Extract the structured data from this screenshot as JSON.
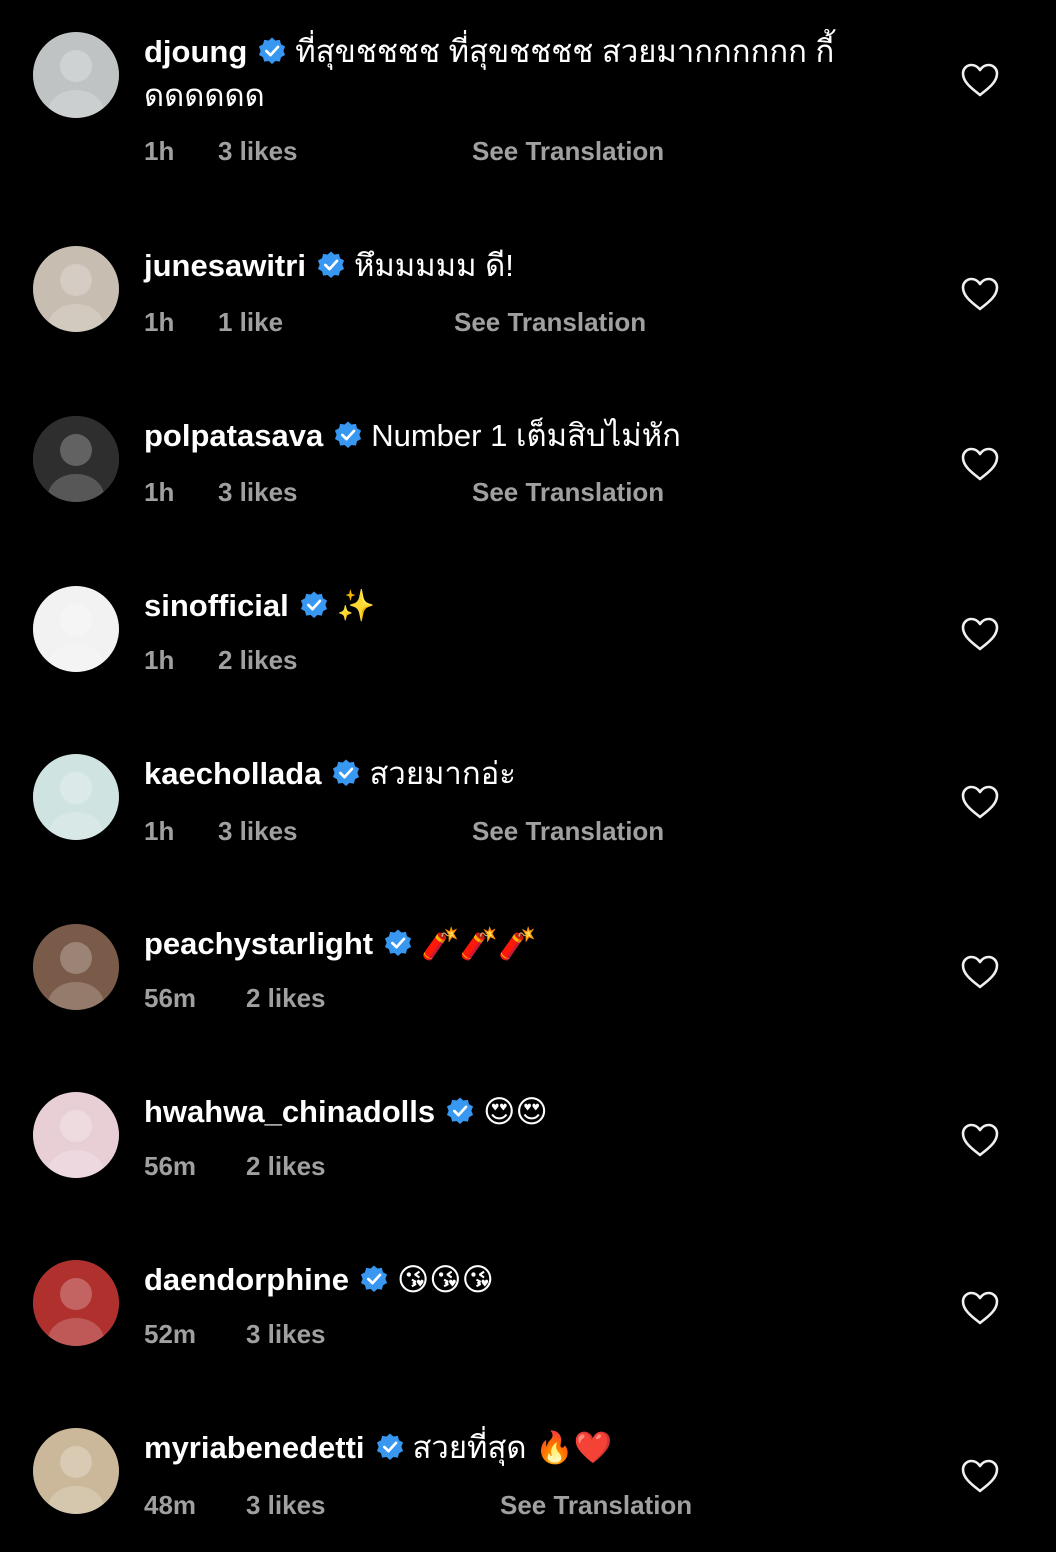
{
  "comments": [
    {
      "username": "djoung",
      "text": "ที่สุขชชชช ที่สุขชชชช สวยมากกกกกก กี้",
      "text2": "ดดดดดด",
      "time": "1h",
      "likes": "3 likes",
      "translate": "See Translation",
      "avatar_color": "#bfc3c4"
    },
    {
      "username": "junesawitri",
      "text": "หึมมมมม ดี!",
      "time": "1h",
      "likes": "1 like",
      "translate": "See Translation",
      "avatar_color": "#c7bdb0"
    },
    {
      "username": "polpatasava",
      "text": "Number 1 เต็มสิบไม่หัก",
      "time": "1h",
      "likes": "3 likes",
      "translate": "See Translation",
      "avatar_color": "#2e2e2e"
    },
    {
      "username": "sinofficial",
      "text": "✨",
      "time": "1h",
      "likes": "2 likes",
      "translate": "",
      "avatar_color": "#f2f2f2"
    },
    {
      "username": "kaechollada",
      "text": "สวยมากอ่ะ",
      "time": "1h",
      "likes": "3 likes",
      "translate": "See Translation",
      "avatar_color": "#cfe3e0"
    },
    {
      "username": "peachystarlight",
      "text": "🧨🧨🧨",
      "time": "56m",
      "likes": "2 likes",
      "translate": "",
      "avatar_color": "#7a5a48"
    },
    {
      "username": "hwahwa_chinadolls",
      "text": "😍😍",
      "time": "56m",
      "likes": "2 likes",
      "translate": "",
      "avatar_color": "#e8cfd6"
    },
    {
      "username": "daendorphine",
      "text": "😘😘😘",
      "time": "52m",
      "likes": "3 likes",
      "translate": "",
      "avatar_color": "#b0302e"
    },
    {
      "username": "myriabenedetti",
      "text": "สวยที่สุด 🔥❤️",
      "time": "48m",
      "likes": "3 likes",
      "translate": "See Translation",
      "avatar_color": "#cbb89a"
    }
  ],
  "colors": {
    "background": "#000000",
    "verified": "#3897f0",
    "meta": "#a0a0a0"
  }
}
